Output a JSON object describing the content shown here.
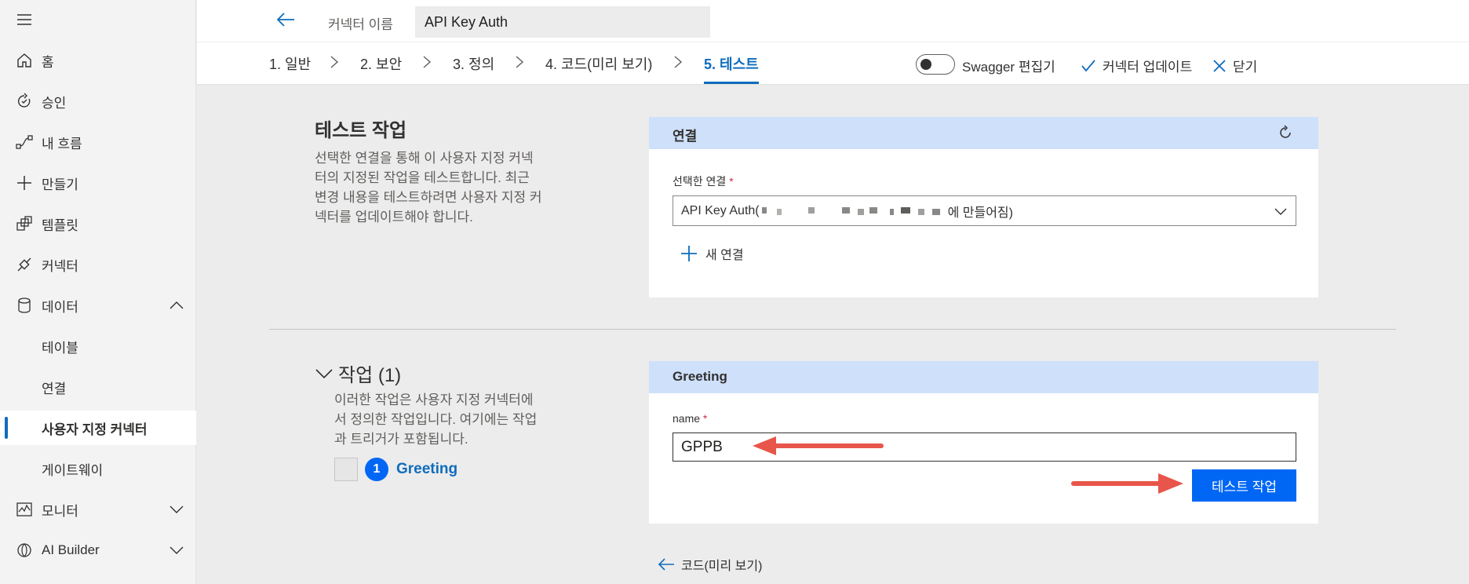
{
  "sidebar": {
    "items": [
      {
        "label": "홈",
        "icon": "home-icon"
      },
      {
        "label": "승인",
        "icon": "approvals-icon"
      },
      {
        "label": "내 흐름",
        "icon": "flows-icon"
      },
      {
        "label": "만들기",
        "icon": "plus-icon"
      },
      {
        "label": "템플릿",
        "icon": "templates-icon"
      },
      {
        "label": "커넥터",
        "icon": "connector-icon"
      },
      {
        "label": "데이터",
        "icon": "database-icon"
      },
      {
        "label": "테이블"
      },
      {
        "label": "연결"
      },
      {
        "label": "사용자 지정 커넥터"
      },
      {
        "label": "게이트웨이"
      },
      {
        "label": "모니터",
        "icon": "monitor-icon"
      },
      {
        "label": "AI Builder",
        "icon": "ai-builder-icon"
      }
    ],
    "active_index": 9
  },
  "header": {
    "connector_name_label": "커넥터 이름",
    "connector_name_value": "API Key Auth",
    "steps": [
      "1. 일반",
      "2. 보안",
      "3. 정의",
      "4. 코드(미리 보기)",
      "5. 테스트"
    ],
    "active_step": 4,
    "swagger_label": "Swagger 편집기",
    "update_label": "커넥터 업데이트",
    "close_label": "닫기"
  },
  "test_operation": {
    "title": "테스트 작업",
    "description": "선택한 연결을 통해 이 사용자 지정 커넥터의 지정된 작업을 테스트합니다. 최근 변경 내용을 테스트하려면 사용자 지정 커넥터를 업데이트해야 합니다.",
    "desc_lines": [
      "선택한 연결을 통해 이 사용자 지정 커넥",
      "터의 지정된 작업을 테스트합니다. 최근",
      "변경 내용을 테스트하려면 사용자 지정 커",
      "넥터를 업데이트해야 합니다."
    ]
  },
  "connection_card": {
    "title": "연결",
    "field_label": "선택한 연결",
    "selected_prefix": "API Key Auth(",
    "selected_suffix": "에 만들어짐)",
    "new_connection_label": "새 연결"
  },
  "operations": {
    "title": "작업 (1)",
    "desc_lines": [
      "이러한 작업은 사용자 지정 커넥터에",
      "서 정의한 작업입니다. 여기에는 작업",
      "과 트리거가 포함됩니다."
    ],
    "items": [
      {
        "number": "1",
        "name": "Greeting"
      }
    ]
  },
  "greeting_card": {
    "title": "Greeting",
    "field_label": "name",
    "field_value": "GPPB",
    "test_button_label": "테스트 작업"
  },
  "footer": {
    "back_label": "코드(미리 보기)"
  },
  "colors": {
    "accent": "#0f6cbd",
    "primary_button": "#0067f5",
    "card_header": "#cfe0fb",
    "annotation_arrow": "#e8554a"
  }
}
